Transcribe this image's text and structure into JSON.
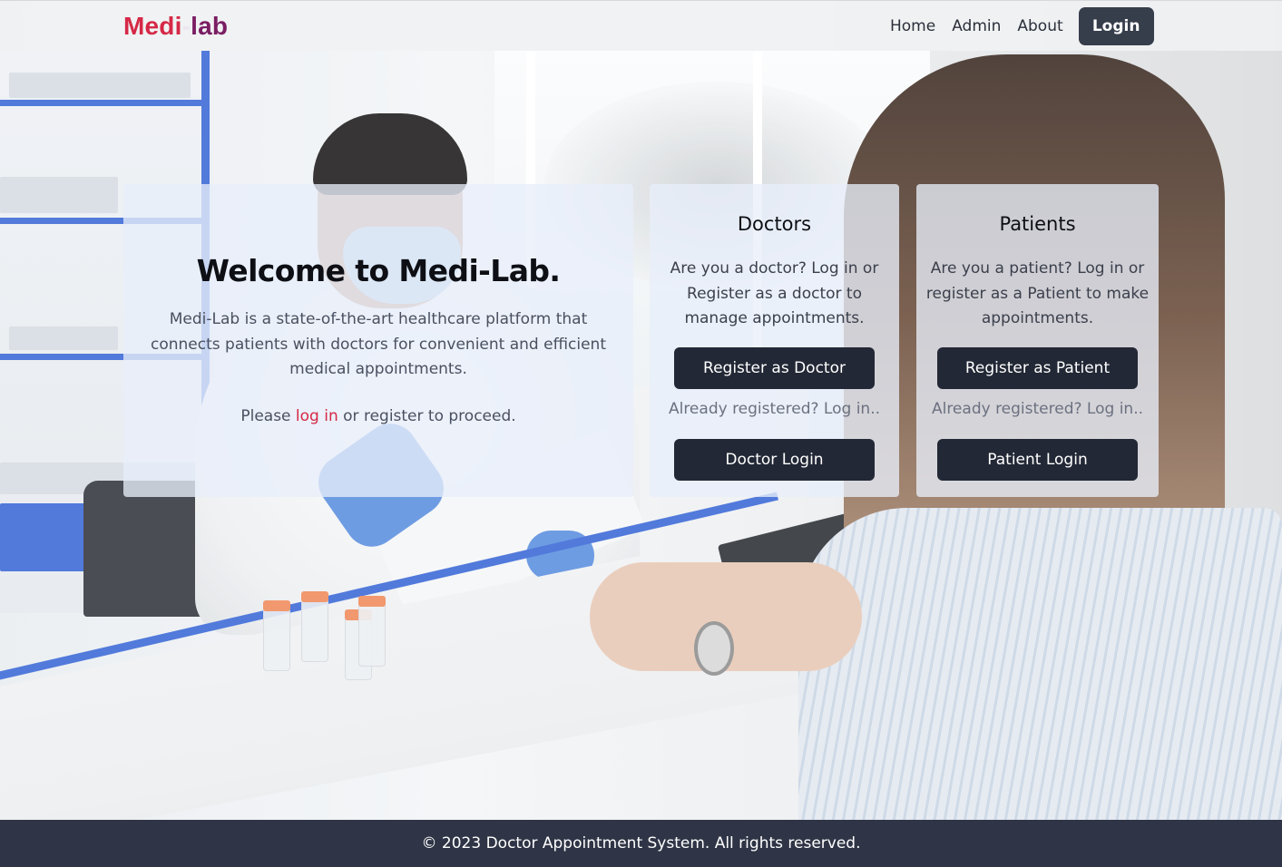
{
  "navbar": {
    "brand": {
      "part1": "Medi",
      "separator": "-",
      "part2": "lab"
    },
    "links": [
      {
        "label": "Home"
      },
      {
        "label": "Admin"
      },
      {
        "label": "About"
      }
    ],
    "login_label": "Login"
  },
  "welcome": {
    "title": "Welcome to Medi-Lab.",
    "description": "Medi-Lab is a state-of-the-art healthcare platform that connects patients with doctors for convenient and efficient medical appointments.",
    "cta_prefix": "Please ",
    "cta_link": "log in",
    "cta_suffix": " or register to proceed."
  },
  "doctors": {
    "title": "Doctors",
    "text": "Are you a doctor? Log in or Register as a doctor to manage appointments.",
    "register_label": "Register as Doctor",
    "already": "Already registered? Log in..",
    "login_label": "Doctor Login"
  },
  "patients": {
    "title": "Patients",
    "text": "Are you a patient? Log in or register as a Patient to make appointments.",
    "register_label": "Register as Patient",
    "already": "Already registered? Log in..",
    "login_label": "Patient Login"
  },
  "footer": {
    "text": "© 2023 Doctor Appointment System. All rights reserved."
  },
  "colors": {
    "brand_red": "#d62846",
    "brand_purple": "#7a1e63",
    "button_dark": "#222835",
    "nav_login_bg": "#363d4b",
    "footer_bg": "#2f3546",
    "link_red": "#d62846"
  },
  "background": {
    "description_icon": "doctor-patient-consultation-photo"
  }
}
